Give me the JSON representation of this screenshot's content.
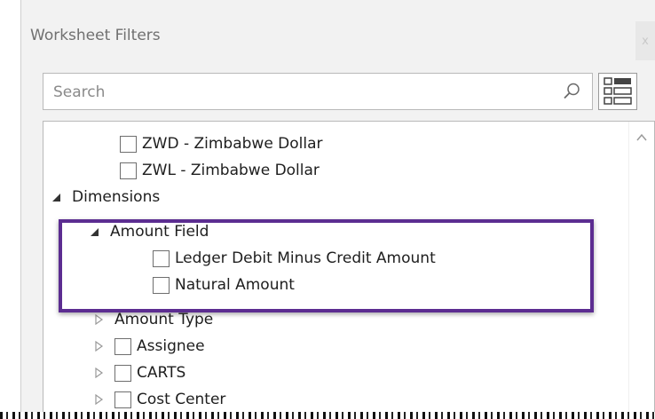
{
  "window": {
    "title": "Worksheet Filters",
    "close_label": "x"
  },
  "search": {
    "placeholder": "Search"
  },
  "tree": {
    "rows": [
      {
        "label": "ZWD - Zimbabwe Dollar",
        "checked": false
      },
      {
        "label": "ZWL - Zimbabwe Dollar",
        "checked": false
      },
      {
        "label": "Dimensions",
        "expanded": true
      },
      {
        "label": "Amount Field",
        "expanded": true
      },
      {
        "label": "Ledger Debit Minus Credit Amount",
        "checked": false
      },
      {
        "label": "Natural Amount",
        "checked": false
      },
      {
        "label": "Amount Type",
        "expanded": false
      },
      {
        "label": "Assignee",
        "expanded": false,
        "checked": false
      },
      {
        "label": "CARTS",
        "expanded": false,
        "checked": false
      },
      {
        "label": "Cost Center",
        "expanded": false,
        "checked": false
      }
    ]
  },
  "colors": {
    "highlight": "#5c2d91",
    "panel_bg": "#f2f2f2"
  }
}
